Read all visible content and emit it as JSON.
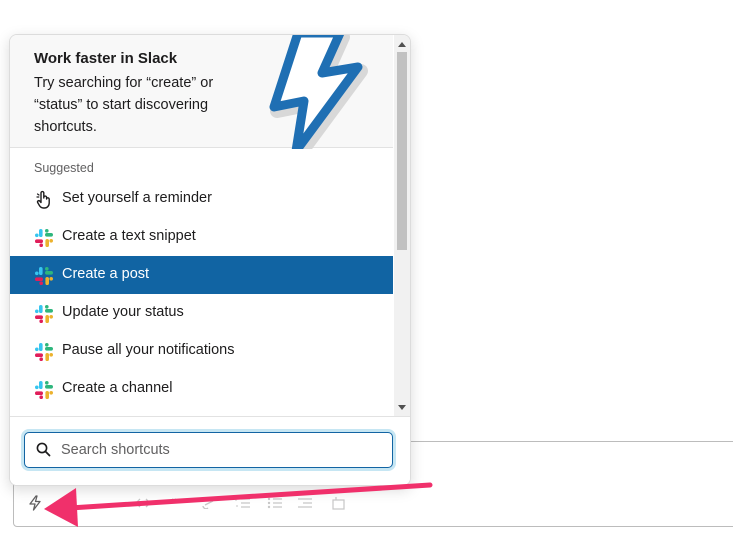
{
  "promo": {
    "title": "Work faster in Slack",
    "text": "Try searching for “create” or “status” to start discovering shortcuts."
  },
  "suggested": {
    "heading": "Suggested",
    "items": [
      {
        "label": "Set yourself a reminder",
        "icon": "hand-pointer-icon"
      },
      {
        "label": "Create a text snippet",
        "icon": "slack-logo-icon"
      },
      {
        "label": "Create a post",
        "icon": "slack-logo-icon",
        "selected": true
      },
      {
        "label": "Update your status",
        "icon": "slack-logo-icon"
      },
      {
        "label": "Pause all your notifications",
        "icon": "slack-logo-icon"
      },
      {
        "label": "Create a channel",
        "icon": "slack-logo-icon"
      }
    ]
  },
  "search": {
    "placeholder": "Search shortcuts",
    "value": ""
  },
  "colors": {
    "selected_bg": "#1164a3",
    "arrow": "#f0306b",
    "lightning": "#1f6fb3"
  }
}
